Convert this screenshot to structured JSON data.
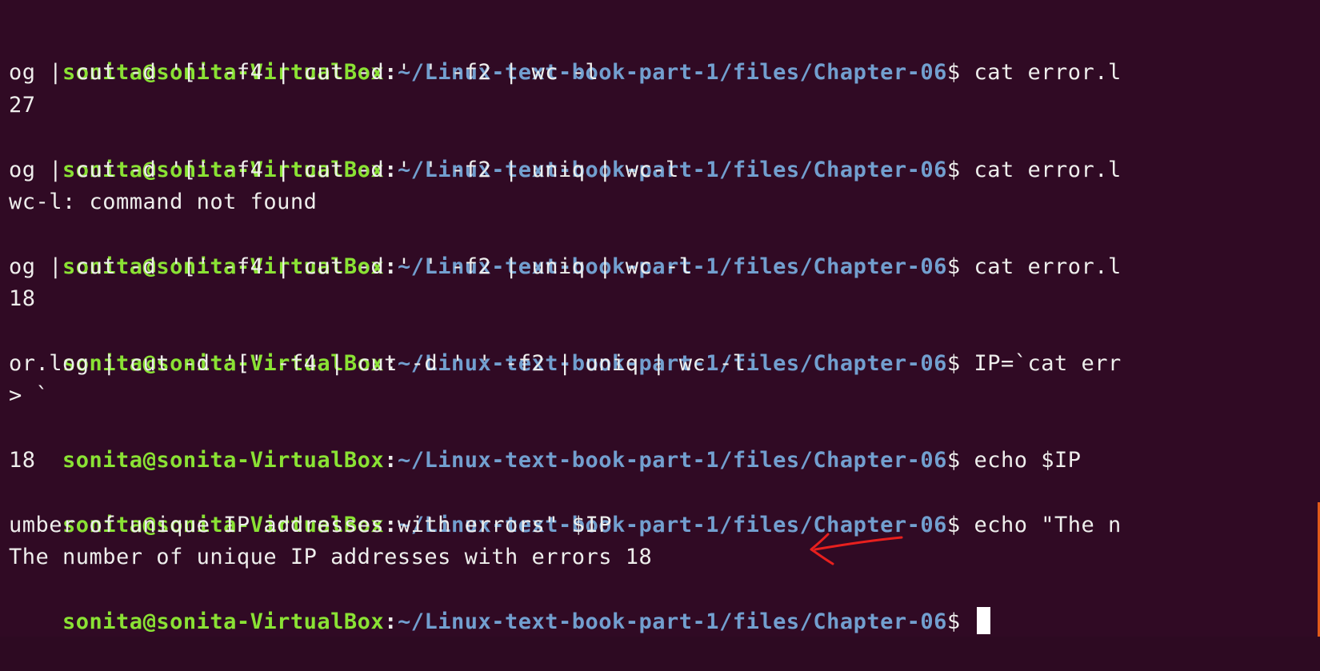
{
  "prompt": {
    "user_host": "sonita@sonita-VirtualBox",
    "separator": ":",
    "path": "~/Linux-text-book-part-1/files/Chapter-06",
    "symbol": "$ "
  },
  "lines": [
    {
      "type": "prompt",
      "command": "cat error.l"
    },
    {
      "type": "text",
      "text": "og | cut -d '[' -f4 | cut -d ' ' -f2 | wc -l"
    },
    {
      "type": "text",
      "text": "27"
    },
    {
      "type": "prompt",
      "command": "cat error.l"
    },
    {
      "type": "text",
      "text": "og | cut -d '[' -f4 | cut -d ' ' -f2 | uniq | wc-l"
    },
    {
      "type": "text",
      "text": "wc-l: command not found"
    },
    {
      "type": "prompt",
      "command": "cat error.l"
    },
    {
      "type": "text",
      "text": "og | cut -d '[' -f4 | cut -d ' ' -f2 | uniq | wc -l"
    },
    {
      "type": "text",
      "text": "18"
    },
    {
      "type": "prompt",
      "command": "IP=`cat err"
    },
    {
      "type": "text",
      "text": "or.log | cut -d '[' -f4 | cut -d ' ' -f2 | uniq | wc -l"
    },
    {
      "type": "text",
      "text": "> `"
    },
    {
      "type": "prompt",
      "command": "echo $IP"
    },
    {
      "type": "text",
      "text": "18"
    },
    {
      "type": "prompt",
      "command": "echo \"The n"
    },
    {
      "type": "text",
      "text": "umber of unique IP addresses with errors\" $IP"
    },
    {
      "type": "text",
      "text": "The number of unique IP addresses with errors 18"
    },
    {
      "type": "prompt",
      "command": "",
      "cursor": true
    }
  ],
  "colors": {
    "background": "#300a24",
    "user_host": "#8ae234",
    "path": "#729fcf",
    "text": "#eeeeec",
    "annotation_arrow": "#e8201e"
  }
}
